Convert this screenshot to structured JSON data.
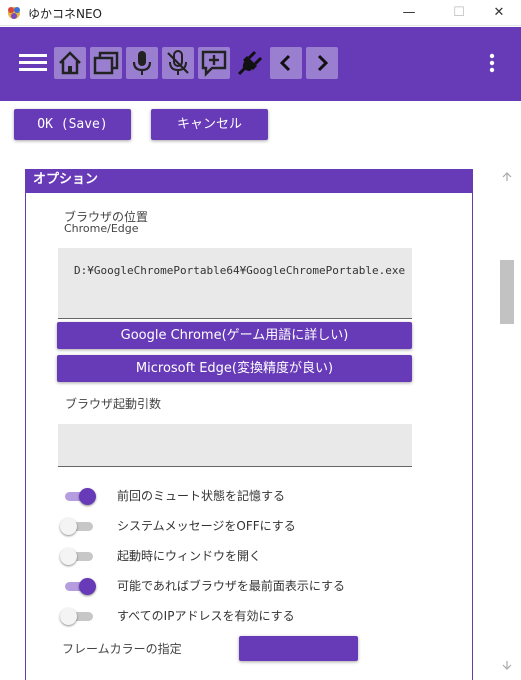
{
  "window": {
    "title": "ゆかコネNEO",
    "minimize_glyph": "—",
    "maximize_glyph": "☐",
    "close_glyph": "✕"
  },
  "toolbar": {
    "icons": [
      "menu-icon",
      "home-icon",
      "window-icon",
      "mic-icon",
      "mic-off-icon",
      "add-message-icon",
      "plug-icon",
      "prev-icon",
      "next-icon",
      "more-vert-icon"
    ]
  },
  "actions": {
    "ok_label": "OK (Save)",
    "cancel_label": "キャンセル"
  },
  "options": {
    "header": "オプション",
    "browser_position_label": "ブラウザの位置",
    "browser_position_sub": "Chrome/Edge",
    "browser_path": "D:¥GoogleChromePortable64¥GoogleChromePortable.exe",
    "chrome_button": "Google Chrome(ゲーム用語に詳しい)",
    "edge_button": "Microsoft Edge(変換精度が良い)",
    "browser_args_label": "ブラウザ起動引数",
    "browser_args_value": "",
    "toggles": [
      {
        "label": "前回のミュート状態を記憶する",
        "on": true
      },
      {
        "label": "システムメッセージをOFFにする",
        "on": false
      },
      {
        "label": "起動時にウィンドウを開く",
        "on": false
      },
      {
        "label": "可能であればブラウザを最前面表示にする",
        "on": true
      },
      {
        "label": "すべてのIPアドレスを有効にする",
        "on": false
      }
    ],
    "frame_color_label": "フレームカラーの指定"
  },
  "colors": {
    "accent": "#673ab7",
    "toolbar_icon_box": "#9a7fd1",
    "toggle_on_track": "#b69de0"
  }
}
